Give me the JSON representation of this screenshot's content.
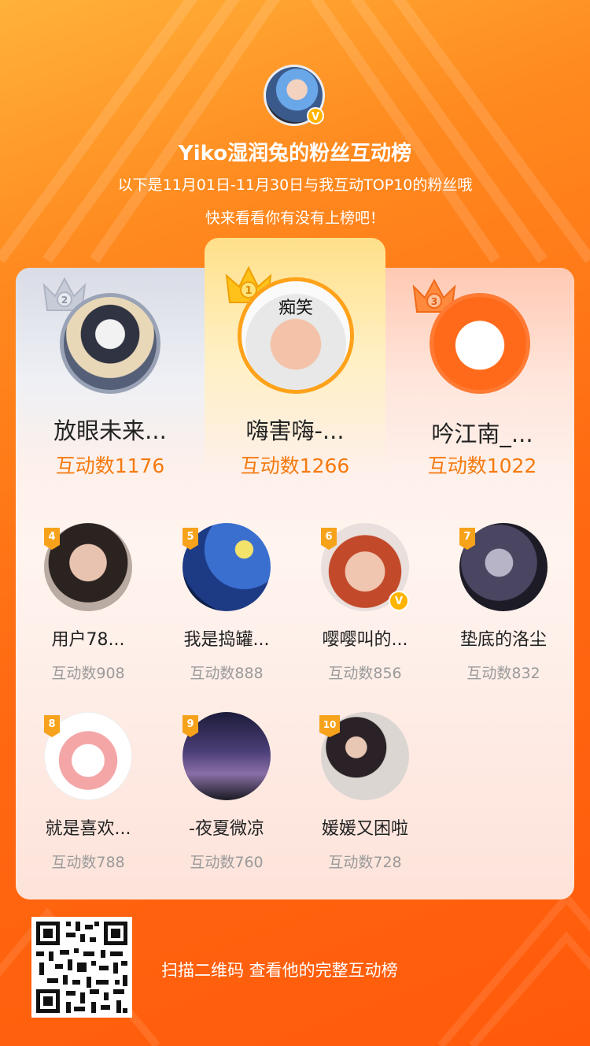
{
  "host": {
    "title": "Yiko湿润兔的粉丝互动榜",
    "subtitle_line1": "以下是11月01日-11月30日与我互动TOP10的粉丝哦",
    "subtitle_line2": "快来看看你有没有上榜吧！",
    "verified_mark": "V"
  },
  "top3": [
    {
      "rank": "1",
      "name": "嗨害嗨-...",
      "count_text": "互动数1266",
      "avatar_caption": "痴笑"
    },
    {
      "rank": "2",
      "name": "放眼未来...",
      "count_text": "互动数1176"
    },
    {
      "rank": "3",
      "name": "吟江南_...",
      "count_text": "互动数1022"
    }
  ],
  "fans": [
    {
      "rank": "4",
      "name": "用户78...",
      "count_text": "互动数908"
    },
    {
      "rank": "5",
      "name": "我是捣罐...",
      "count_text": "互动数888"
    },
    {
      "rank": "6",
      "name": "嘤嘤叫的...",
      "count_text": "互动数856",
      "verified": true
    },
    {
      "rank": "7",
      "name": "垫底的洛尘",
      "count_text": "互动数832"
    },
    {
      "rank": "8",
      "name": "就是喜欢...",
      "count_text": "互动数788"
    },
    {
      "rank": "9",
      "name": "-夜夏微凉",
      "count_text": "互动数760"
    },
    {
      "rank": "10",
      "name": "媛媛又困啦",
      "count_text": "互动数728"
    }
  ],
  "footer": {
    "qr_hint": "扫描二维码 查看他的完整互动榜"
  },
  "colors": {
    "accent": "#f57a0f",
    "gold": "#f7a21b",
    "background_orange": "#ff6a12"
  }
}
